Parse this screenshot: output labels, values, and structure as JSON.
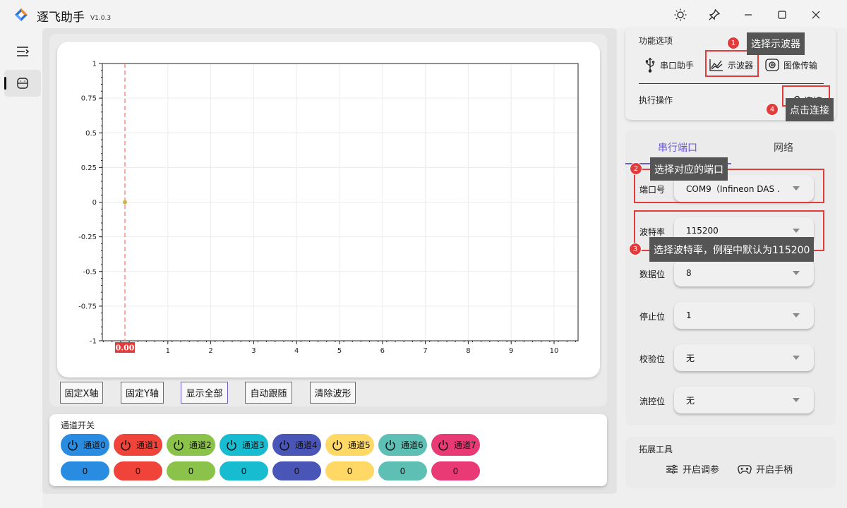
{
  "app": {
    "title": "逐飞助手",
    "version": "V1.0.3"
  },
  "plot": {
    "y_ticks": [
      "1",
      "0.75",
      "0.5",
      "0.25",
      "0",
      "-0.25",
      "-0.5",
      "-0.75",
      "-1"
    ],
    "x_ticks": [
      "1",
      "2",
      "3",
      "4",
      "5",
      "6",
      "7",
      "8",
      "9",
      "10"
    ],
    "cursor_label": "0.00",
    "colors": {
      "cursor": "#f08080",
      "cursor_label_bg": "#e23b3b",
      "point": "#c8b84a"
    }
  },
  "controls": [
    "固定X轴",
    "固定Y轴",
    "显示全部",
    "自动跟随",
    "清除波形"
  ],
  "channels": {
    "title": "通道开关",
    "items": [
      {
        "label": "通道0",
        "value": "0",
        "color": "#2a8ce0"
      },
      {
        "label": "通道1",
        "value": "0",
        "color": "#f0443a"
      },
      {
        "label": "通道2",
        "value": "0",
        "color": "#8bc34a"
      },
      {
        "label": "通道3",
        "value": "0",
        "color": "#18bcd0"
      },
      {
        "label": "通道4",
        "value": "0",
        "color": "#4a55b8"
      },
      {
        "label": "通道5",
        "value": "0",
        "color": "#ffd866"
      },
      {
        "label": "通道6",
        "value": "0",
        "color": "#5ec0b4"
      },
      {
        "label": "通道7",
        "value": "0",
        "color": "#ea3a76"
      }
    ]
  },
  "functions": {
    "title": "功能选项",
    "items": [
      "串口助手",
      "示波器",
      "图像传输"
    ],
    "action_title": "执行操作",
    "connect_label": "连接"
  },
  "tips": [
    {
      "num": "1",
      "text": "选择示波器"
    },
    {
      "num": "2",
      "text": "选择对应的端口"
    },
    {
      "num": "3",
      "text": "选择波特率，例程中默认为115200"
    },
    {
      "num": "4",
      "text": "点击连接"
    }
  ],
  "serial": {
    "tabs": [
      "串行端口",
      "网络"
    ],
    "fields": [
      {
        "label": "端口号",
        "value": "COM9（Infineon DAS ."
      },
      {
        "label": "波特率",
        "value": "115200"
      },
      {
        "label": "数据位",
        "value": "8"
      },
      {
        "label": "停止位",
        "value": "1"
      },
      {
        "label": "校验位",
        "value": "无"
      },
      {
        "label": "流控位",
        "value": "无"
      }
    ]
  },
  "extensions": {
    "title": "拓展工具",
    "items": [
      "开启调参",
      "开启手柄"
    ]
  }
}
